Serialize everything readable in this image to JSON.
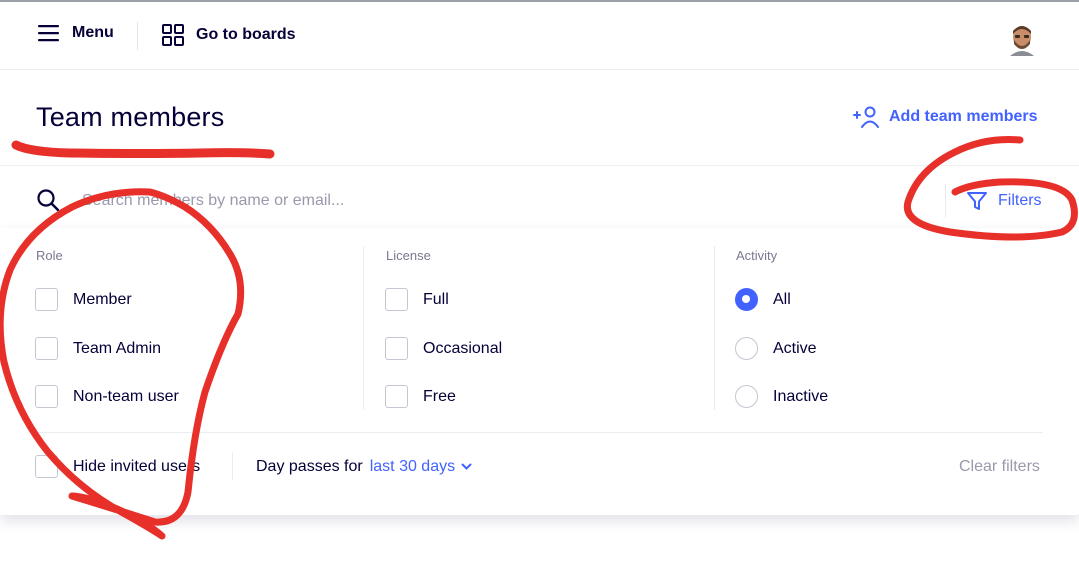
{
  "topbar": {
    "menu_label": "Menu",
    "boards_label": "Go to boards"
  },
  "page": {
    "title": "Team members",
    "add_label": "Add team members"
  },
  "search": {
    "placeholder": "Search members by name or email...",
    "value": ""
  },
  "filters": {
    "label": "Filters",
    "role": {
      "title": "Role",
      "options": [
        "Member",
        "Team Admin",
        "Non-team user"
      ]
    },
    "license": {
      "title": "License",
      "options": [
        "Full",
        "Occasional",
        "Free"
      ]
    },
    "activity": {
      "title": "Activity",
      "options": [
        "All",
        "Active",
        "Inactive"
      ],
      "selected": "All"
    },
    "hide_invited_label": "Hide invited users",
    "day_passes_label": "Day passes for",
    "day_passes_value": "last 30 days",
    "clear_label": "Clear filters"
  },
  "colors": {
    "accent": "#4262ff",
    "text": "#050038",
    "annotation": "#e8302a"
  },
  "icons": {
    "menu": "hamburger-icon",
    "boards": "grid-icon",
    "add": "add-user-icon",
    "search": "search-icon",
    "filter": "funnel-icon",
    "dropdown": "chevron-down-icon"
  }
}
